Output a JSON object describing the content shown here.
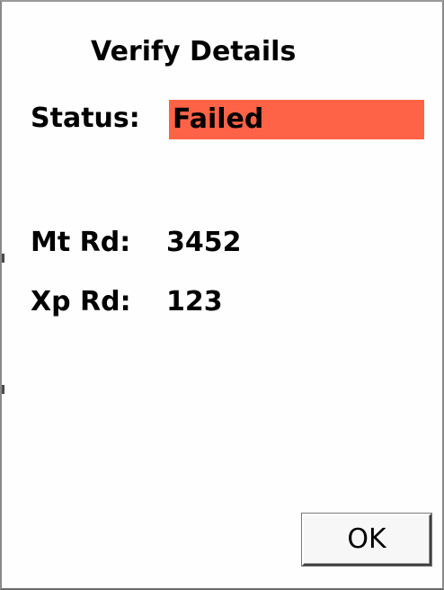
{
  "dialog": {
    "title": "Verify Details"
  },
  "status": {
    "label": "Status:",
    "value": "Failed",
    "color": "#ff6347"
  },
  "readings": [
    {
      "label": "Mt Rd:",
      "value": "3452"
    },
    {
      "label": "Xp Rd:",
      "value": "123"
    }
  ],
  "buttons": {
    "ok_label": "OK"
  }
}
